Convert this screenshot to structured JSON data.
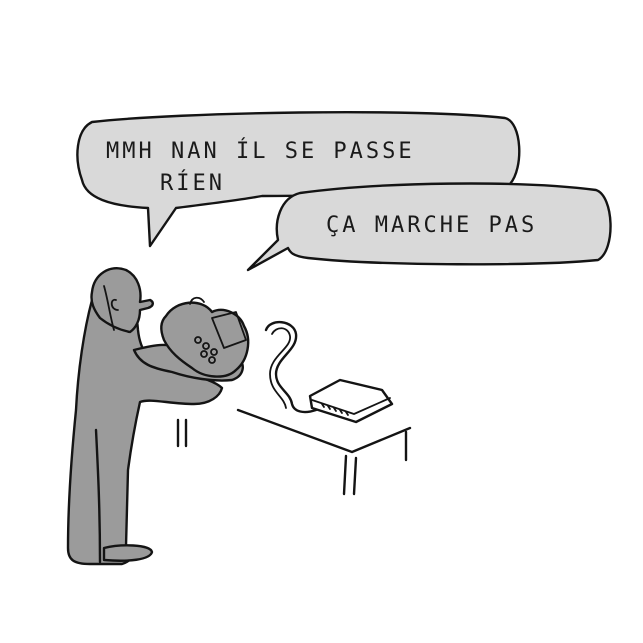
{
  "speech_bubbles": [
    {
      "lines": [
        "MMH NAN ÍL SE PASSE",
        "RÍEN"
      ]
    },
    {
      "lines": [
        "ÇA MARCHE PAS"
      ]
    }
  ],
  "colors": {
    "background": "#ffffff",
    "bubble_fill": "#d9d9d9",
    "figure_fill": "#9b9b9b",
    "ink": "#141414"
  }
}
